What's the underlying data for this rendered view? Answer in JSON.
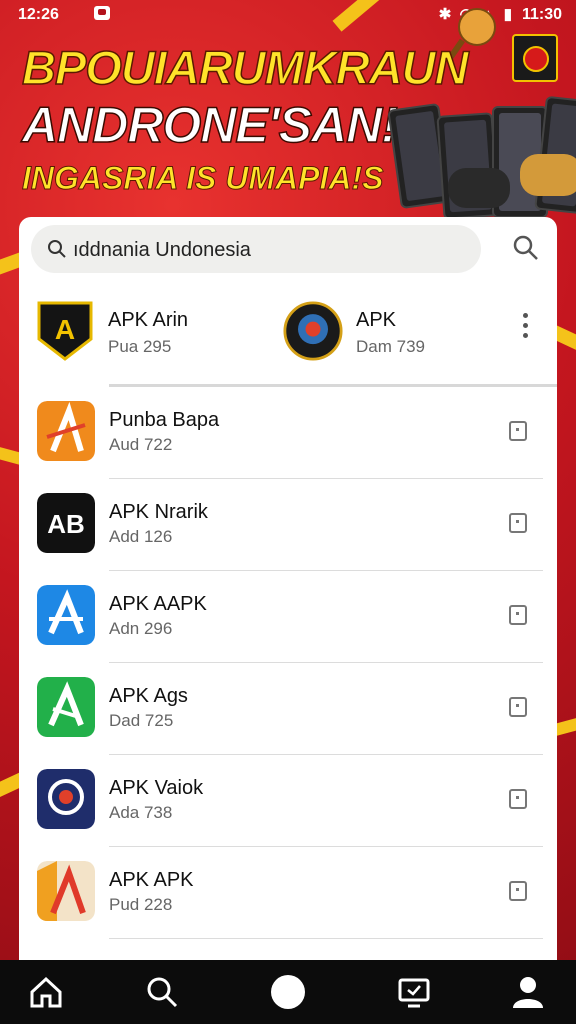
{
  "status_bar": {
    "time_left": "12:26",
    "time_right": "11:30",
    "icons": "✱ ◠ ▲ ▮"
  },
  "banner": {
    "headline_1": "BPOUIARUMKRAUN",
    "headline_2": "ANDRONE'SAN!",
    "headline_3": "INGASRIA IS UMAPIA!S",
    "accent_color": "#ffe32a"
  },
  "search": {
    "value": "ıddnania Undonesia",
    "icon": "search-icon",
    "button_icon": "search-icon"
  },
  "featured": [
    {
      "name": "APK Arin",
      "sub": "Pua 295",
      "icon": "shield-logo-icon"
    },
    {
      "name": "APK",
      "sub": "Dam 739",
      "icon": "emblem-logo-icon"
    }
  ],
  "apps": [
    {
      "title": "Punba Bapa",
      "meta": "Aud 722",
      "icon": "orange-a-icon",
      "color": "#f08a1c"
    },
    {
      "title": "APK Nrarik",
      "meta": "Add 126",
      "icon": "ab-icon",
      "color": "#111111"
    },
    {
      "title": "APK AAPK",
      "meta": "Adn 296",
      "icon": "blue-a-icon",
      "color": "#1e88e5"
    },
    {
      "title": "APK Ags",
      "meta": "Dad 725",
      "icon": "green-a-icon",
      "color": "#22b04a"
    },
    {
      "title": "APK Vaiok",
      "meta": "Ada 738",
      "icon": "navy-emblem-icon",
      "color": "#1f2d6b"
    },
    {
      "title": "APK APK",
      "meta": "Pud 228",
      "icon": "red-a-icon",
      "color": "#e03a2a"
    }
  ],
  "nav": [
    "home-icon",
    "discover-icon",
    "circle-icon",
    "tv-icon",
    "profile-icon"
  ]
}
